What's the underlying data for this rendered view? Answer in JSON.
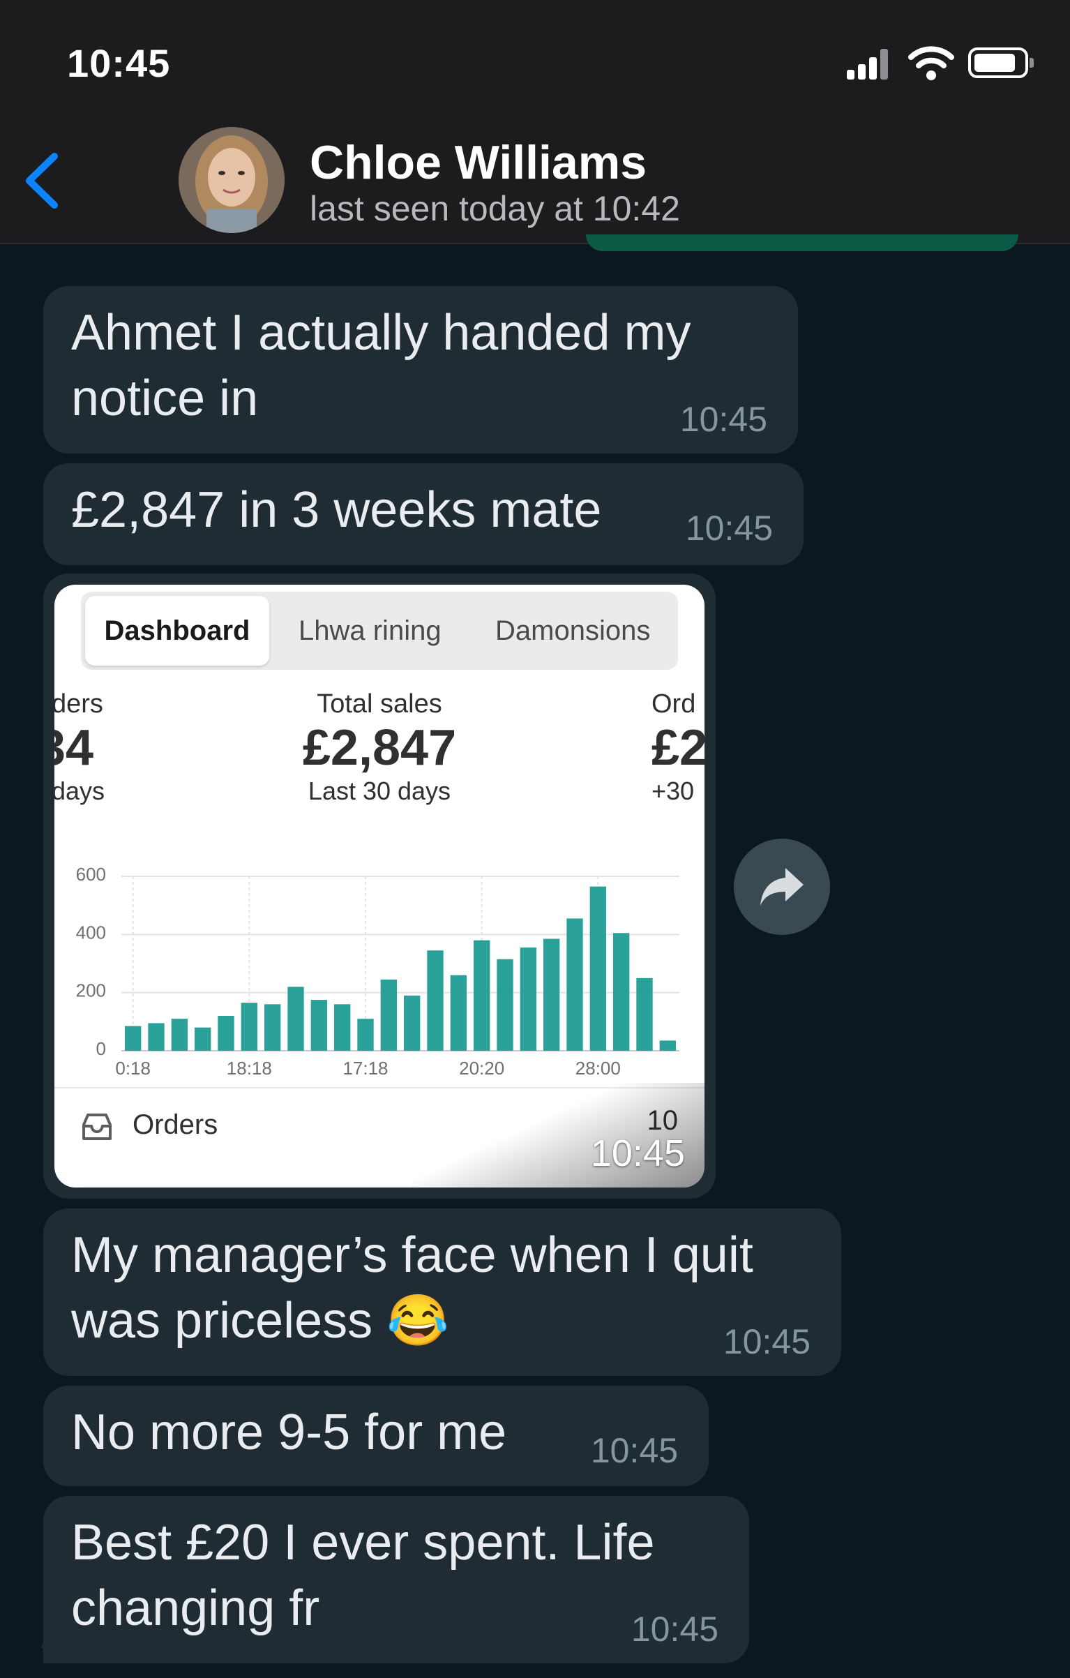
{
  "status_bar": {
    "time": "10:45"
  },
  "header": {
    "contact_name": "Chloe Williams",
    "last_seen": "last seen today at 10:42",
    "back_icon": "chevron-left-icon"
  },
  "messages": [
    {
      "text": "Ahmet I actually handed my notice in",
      "time": "10:45"
    },
    {
      "text": "£2,847 in 3 weeks mate",
      "time": "10:45"
    },
    {
      "text": "My manager’s face when I quit was priceless 😂",
      "time": "10:45"
    },
    {
      "text": "No more 9-5 for me",
      "time": "10:45"
    },
    {
      "text": "Best £20 I ever spent. Life changing fr",
      "time": "10:45"
    }
  ],
  "image_message": {
    "time": "10:45",
    "dashboard": {
      "tabs": [
        "Dashboard",
        "Lhwa rining",
        "Damonsions"
      ],
      "metric_left": {
        "label": "ders",
        "value": "34",
        "sub": "days"
      },
      "metric_center": {
        "label": "Total sales",
        "value": "£2,847",
        "sub": "Last 30 days"
      },
      "metric_right": {
        "label": "Ord",
        "value": "£2",
        "sub": "+30"
      },
      "orders_label": "Orders",
      "orders_count": "10"
    }
  },
  "chart_data": {
    "type": "bar",
    "x_ticks": [
      "0:18",
      "18:18",
      "17:18",
      "20:20",
      "28:00"
    ],
    "y_ticks": [
      "0",
      "200",
      "400",
      "600"
    ],
    "ylim": [
      0,
      600
    ],
    "values": [
      85,
      95,
      110,
      80,
      120,
      165,
      160,
      220,
      175,
      160,
      110,
      245,
      190,
      345,
      260,
      380,
      315,
      355,
      385,
      455,
      565,
      405,
      250,
      35
    ],
    "grid": true,
    "bar_color": "#2aa198"
  },
  "colors": {
    "background": "#0b1820",
    "bubble": "#1f2c34",
    "accent": "#0a84ff",
    "timestamp": "#8696a0"
  }
}
